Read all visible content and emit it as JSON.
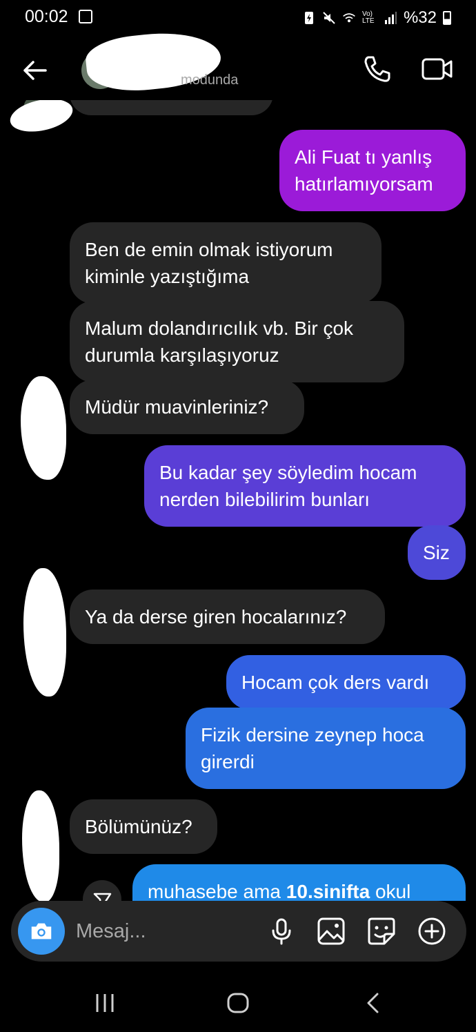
{
  "status_bar": {
    "time": "00:02",
    "battery_text": "%32",
    "network_text": "Vo) LTE",
    "icons": [
      "gallery-icon",
      "battery-saver-icon",
      "mute-icon",
      "wifi-icon",
      "volte-icon",
      "signal-icon",
      "battery-icon"
    ]
  },
  "header": {
    "subtitle": "modunda",
    "icons": [
      "back-icon",
      "call-icon",
      "video-call-icon"
    ]
  },
  "messages": [
    {
      "side": "sent",
      "text": "Ali Fuat tı yanlış hatırlamıyorsam",
      "color": "#9b1bd8"
    },
    {
      "side": "received",
      "text": "Ben de emin olmak istiyorum kiminle yazıştığıma"
    },
    {
      "side": "received",
      "text": "Malum dolandırıcılık vb. Bir çok durumla karşılaşıyoruz"
    },
    {
      "side": "received",
      "text": "Müdür muavinleriniz?"
    },
    {
      "side": "sent",
      "text": "Bu kadar şey söyledim hocam nerden bilebilirim bunları",
      "color": "#5a3ed6"
    },
    {
      "side": "sent",
      "text": "Siz",
      "color": "#4d49d8"
    },
    {
      "side": "received",
      "text": "Ya da derse giren hocalarınız?"
    },
    {
      "side": "sent",
      "text": "Hocam çok ders vardı",
      "color": "#3260e2"
    },
    {
      "side": "sent",
      "text": "Fizik dersine zeynep hoca girerdi",
      "color": "#2a6fe0"
    },
    {
      "side": "received",
      "text": "Bölümünüz?"
    },
    {
      "side": "sent",
      "text_parts": [
        "muhasebe ama ",
        "10.sinifta",
        " okul"
      ],
      "color": "#1f8ae8"
    }
  ],
  "composer": {
    "placeholder": "Mesaj...",
    "accent": "#3797f0",
    "icons": [
      "camera-icon",
      "microphone-icon",
      "gallery-icon",
      "sticker-icon",
      "add-icon"
    ]
  },
  "nav_bar": {
    "icons": [
      "recents-icon",
      "home-icon",
      "back-nav-icon"
    ]
  }
}
